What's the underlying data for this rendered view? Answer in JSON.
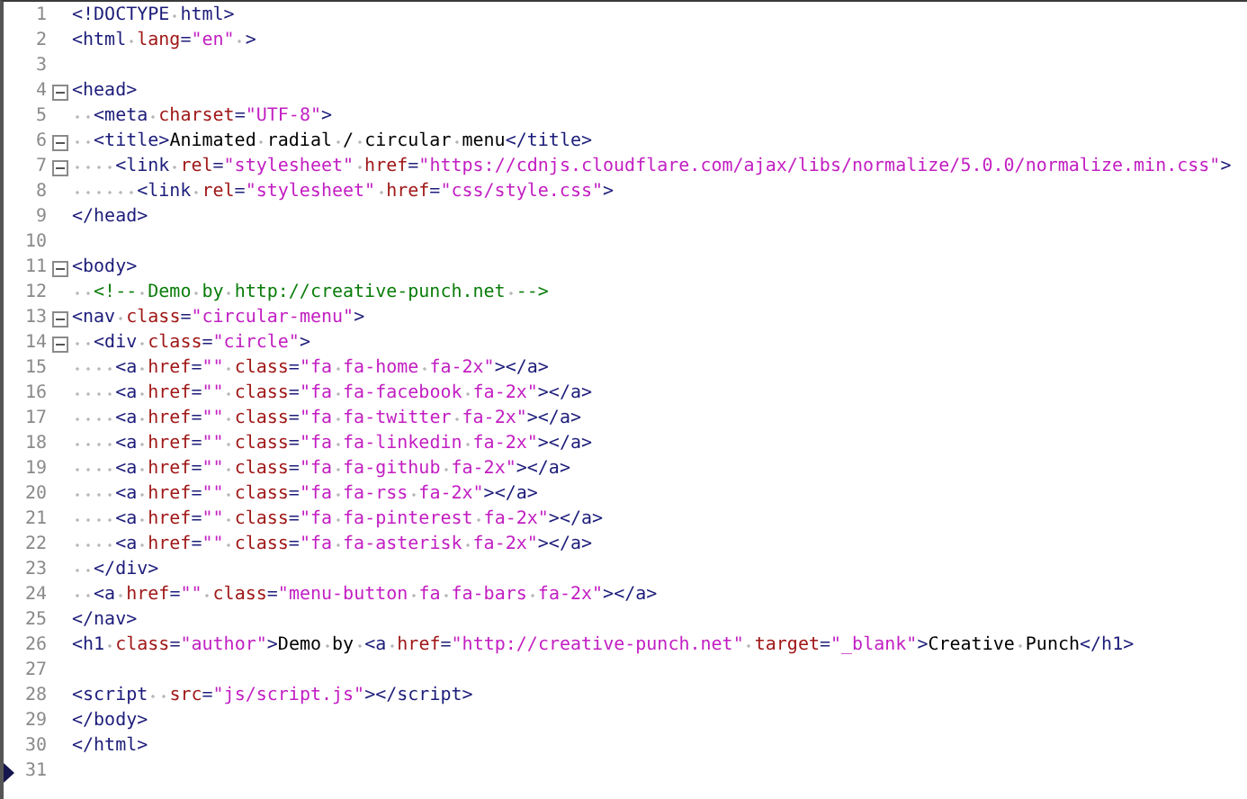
{
  "editor": {
    "lines": [
      {
        "n": "1",
        "fold": false,
        "current": false,
        "tokens": [
          {
            "kind": "tag",
            "text": "<!DOCTYPE html>"
          }
        ]
      },
      {
        "n": "2",
        "fold": false,
        "current": false,
        "tokens": [
          {
            "kind": "tag",
            "text": "<html "
          },
          {
            "kind": "attr",
            "text": "lang"
          },
          {
            "kind": "tag",
            "text": "="
          },
          {
            "kind": "value",
            "text": "\"en\""
          },
          {
            "kind": "tag",
            "text": " >"
          }
        ]
      },
      {
        "n": "3",
        "fold": false,
        "current": false
      },
      {
        "n": "4",
        "fold": true,
        "current": false,
        "tokens": [
          {
            "kind": "tag",
            "text": "<head>"
          }
        ]
      },
      {
        "n": "5",
        "fold": false,
        "current": false,
        "tokens": [
          {
            "kind": "tag",
            "text": "  <meta "
          },
          {
            "kind": "attr",
            "text": "charset"
          },
          {
            "kind": "tag",
            "text": "="
          },
          {
            "kind": "value",
            "text": "\"UTF-8\""
          },
          {
            "kind": "tag",
            "text": ">"
          }
        ]
      },
      {
        "n": "6",
        "fold": true,
        "current": false,
        "tokens": [
          {
            "kind": "tag",
            "text": "  <title>"
          },
          {
            "kind": "text",
            "text": "Animated radial / circular menu"
          },
          {
            "kind": "tag",
            "text": "</title>"
          }
        ]
      },
      {
        "n": "7",
        "fold": true,
        "current": false,
        "tokens": [
          {
            "kind": "tag",
            "text": "    <link "
          },
          {
            "kind": "attr",
            "text": "rel"
          },
          {
            "kind": "tag",
            "text": "="
          },
          {
            "kind": "value",
            "text": "\"stylesheet\" "
          },
          {
            "kind": "attr",
            "text": "href"
          },
          {
            "kind": "tag",
            "text": "="
          },
          {
            "kind": "value",
            "text": "\"https://cdnjs.cloudflare.com/ajax/libs/normalize/5.0.0/normalize.min.css\""
          },
          {
            "kind": "tag",
            "text": ">"
          }
        ]
      },
      {
        "n": "8",
        "fold": false,
        "current": false,
        "tokens": [
          {
            "kind": "tag",
            "text": "      <link "
          },
          {
            "kind": "attr",
            "text": "rel"
          },
          {
            "kind": "tag",
            "text": "="
          },
          {
            "kind": "value",
            "text": "\"stylesheet\" "
          },
          {
            "kind": "attr",
            "text": "href"
          },
          {
            "kind": "tag",
            "text": "="
          },
          {
            "kind": "value",
            "text": "\"css/style.css\""
          },
          {
            "kind": "tag",
            "text": ">"
          }
        ]
      },
      {
        "n": "9",
        "fold": false,
        "current": false,
        "tokens": [
          {
            "kind": "tag",
            "text": "</head>"
          }
        ]
      },
      {
        "n": "10",
        "fold": false,
        "current": false
      },
      {
        "n": "11",
        "fold": true,
        "current": false,
        "tokens": [
          {
            "kind": "tag",
            "text": "<body>"
          }
        ]
      },
      {
        "n": "12",
        "fold": false,
        "current": false,
        "tokens": [
          {
            "kind": "comment",
            "text": "  <!-- Demo by http://creative-punch.net -->"
          }
        ]
      },
      {
        "n": "13",
        "fold": true,
        "current": false,
        "tokens": [
          {
            "kind": "tag",
            "text": "<nav "
          },
          {
            "kind": "attr",
            "text": "class"
          },
          {
            "kind": "tag",
            "text": "="
          },
          {
            "kind": "value",
            "text": "\"circular-menu\""
          },
          {
            "kind": "tag",
            "text": ">"
          }
        ]
      },
      {
        "n": "14",
        "fold": true,
        "current": false,
        "tokens": [
          {
            "kind": "tag",
            "text": "  <div "
          },
          {
            "kind": "attr",
            "text": "class"
          },
          {
            "kind": "tag",
            "text": "="
          },
          {
            "kind": "value",
            "text": "\"circle\""
          },
          {
            "kind": "tag",
            "text": ">"
          }
        ]
      },
      {
        "n": "15",
        "fold": false,
        "current": false,
        "tokens": [
          {
            "kind": "tag",
            "text": "    <a "
          },
          {
            "kind": "attr",
            "text": "href"
          },
          {
            "kind": "tag",
            "text": "="
          },
          {
            "kind": "value",
            "text": "\"\" "
          },
          {
            "kind": "attr",
            "text": "class"
          },
          {
            "kind": "tag",
            "text": "="
          },
          {
            "kind": "value",
            "text": "\"fa fa-home fa-2x\""
          },
          {
            "kind": "tag",
            "text": "></a>"
          }
        ]
      },
      {
        "n": "16",
        "fold": false,
        "current": false,
        "tokens": [
          {
            "kind": "tag",
            "text": "    <a "
          },
          {
            "kind": "attr",
            "text": "href"
          },
          {
            "kind": "tag",
            "text": "="
          },
          {
            "kind": "value",
            "text": "\"\" "
          },
          {
            "kind": "attr",
            "text": "class"
          },
          {
            "kind": "tag",
            "text": "="
          },
          {
            "kind": "value",
            "text": "\"fa fa-facebook fa-2x\""
          },
          {
            "kind": "tag",
            "text": "></a>"
          }
        ]
      },
      {
        "n": "17",
        "fold": false,
        "current": false,
        "tokens": [
          {
            "kind": "tag",
            "text": "    <a "
          },
          {
            "kind": "attr",
            "text": "href"
          },
          {
            "kind": "tag",
            "text": "="
          },
          {
            "kind": "value",
            "text": "\"\" "
          },
          {
            "kind": "attr",
            "text": "class"
          },
          {
            "kind": "tag",
            "text": "="
          },
          {
            "kind": "value",
            "text": "\"fa fa-twitter fa-2x\""
          },
          {
            "kind": "tag",
            "text": "></a>"
          }
        ]
      },
      {
        "n": "18",
        "fold": false,
        "current": false,
        "tokens": [
          {
            "kind": "tag",
            "text": "    <a "
          },
          {
            "kind": "attr",
            "text": "href"
          },
          {
            "kind": "tag",
            "text": "="
          },
          {
            "kind": "value",
            "text": "\"\" "
          },
          {
            "kind": "attr",
            "text": "class"
          },
          {
            "kind": "tag",
            "text": "="
          },
          {
            "kind": "value",
            "text": "\"fa fa-linkedin fa-2x\""
          },
          {
            "kind": "tag",
            "text": "></a>"
          }
        ]
      },
      {
        "n": "19",
        "fold": false,
        "current": false,
        "tokens": [
          {
            "kind": "tag",
            "text": "    <a "
          },
          {
            "kind": "attr",
            "text": "href"
          },
          {
            "kind": "tag",
            "text": "="
          },
          {
            "kind": "value",
            "text": "\"\" "
          },
          {
            "kind": "attr",
            "text": "class"
          },
          {
            "kind": "tag",
            "text": "="
          },
          {
            "kind": "value",
            "text": "\"fa fa-github fa-2x\""
          },
          {
            "kind": "tag",
            "text": "></a>"
          }
        ]
      },
      {
        "n": "20",
        "fold": false,
        "current": false,
        "tokens": [
          {
            "kind": "tag",
            "text": "    <a "
          },
          {
            "kind": "attr",
            "text": "href"
          },
          {
            "kind": "tag",
            "text": "="
          },
          {
            "kind": "value",
            "text": "\"\" "
          },
          {
            "kind": "attr",
            "text": "class"
          },
          {
            "kind": "tag",
            "text": "="
          },
          {
            "kind": "value",
            "text": "\"fa fa-rss fa-2x\""
          },
          {
            "kind": "tag",
            "text": "></a>"
          }
        ]
      },
      {
        "n": "21",
        "fold": false,
        "current": false,
        "tokens": [
          {
            "kind": "tag",
            "text": "    <a "
          },
          {
            "kind": "attr",
            "text": "href"
          },
          {
            "kind": "tag",
            "text": "="
          },
          {
            "kind": "value",
            "text": "\"\" "
          },
          {
            "kind": "attr",
            "text": "class"
          },
          {
            "kind": "tag",
            "text": "="
          },
          {
            "kind": "value",
            "text": "\"fa fa-pinterest fa-2x\""
          },
          {
            "kind": "tag",
            "text": "></a>"
          }
        ]
      },
      {
        "n": "22",
        "fold": false,
        "current": false,
        "tokens": [
          {
            "kind": "tag",
            "text": "    <a "
          },
          {
            "kind": "attr",
            "text": "href"
          },
          {
            "kind": "tag",
            "text": "="
          },
          {
            "kind": "value",
            "text": "\"\" "
          },
          {
            "kind": "attr",
            "text": "class"
          },
          {
            "kind": "tag",
            "text": "="
          },
          {
            "kind": "value",
            "text": "\"fa fa-asterisk fa-2x\""
          },
          {
            "kind": "tag",
            "text": "></a>"
          }
        ]
      },
      {
        "n": "23",
        "fold": false,
        "current": false,
        "tokens": [
          {
            "kind": "tag",
            "text": "  </div>"
          }
        ]
      },
      {
        "n": "24",
        "fold": false,
        "current": false,
        "tokens": [
          {
            "kind": "tag",
            "text": "  <a "
          },
          {
            "kind": "attr",
            "text": "href"
          },
          {
            "kind": "tag",
            "text": "="
          },
          {
            "kind": "value",
            "text": "\"\" "
          },
          {
            "kind": "attr",
            "text": "class"
          },
          {
            "kind": "tag",
            "text": "="
          },
          {
            "kind": "value",
            "text": "\"menu-button fa fa-bars fa-2x\""
          },
          {
            "kind": "tag",
            "text": "></a>"
          }
        ]
      },
      {
        "n": "25",
        "fold": false,
        "current": false,
        "tokens": [
          {
            "kind": "tag",
            "text": "</nav>"
          }
        ]
      },
      {
        "n": "26",
        "fold": false,
        "current": false,
        "tokens": [
          {
            "kind": "tag",
            "text": "<h1 "
          },
          {
            "kind": "attr",
            "text": "class"
          },
          {
            "kind": "tag",
            "text": "="
          },
          {
            "kind": "value",
            "text": "\"author\""
          },
          {
            "kind": "tag",
            "text": ">"
          },
          {
            "kind": "text",
            "text": "Demo by "
          },
          {
            "kind": "tag",
            "text": "<a "
          },
          {
            "kind": "attr",
            "text": "href"
          },
          {
            "kind": "tag",
            "text": "="
          },
          {
            "kind": "value",
            "text": "\"http://creative-punch.net\" "
          },
          {
            "kind": "attr",
            "text": "target"
          },
          {
            "kind": "tag",
            "text": "="
          },
          {
            "kind": "value",
            "text": "\"_blank\""
          },
          {
            "kind": "tag",
            "text": ">"
          },
          {
            "kind": "text",
            "text": "Creative Punch"
          },
          {
            "kind": "tag",
            "text": "</h1>"
          }
        ]
      },
      {
        "n": "27",
        "fold": false,
        "current": false
      },
      {
        "n": "28",
        "fold": false,
        "current": false,
        "tokens": [
          {
            "kind": "tag",
            "text": "<script  "
          },
          {
            "kind": "attr",
            "text": "src"
          },
          {
            "kind": "tag",
            "text": "="
          },
          {
            "kind": "value",
            "text": "\"js/script.js\""
          },
          {
            "kind": "tag",
            "text": "></script>"
          }
        ]
      },
      {
        "n": "29",
        "fold": false,
        "current": false,
        "tokens": [
          {
            "kind": "tag",
            "text": "</body>"
          }
        ]
      },
      {
        "n": "30",
        "fold": false,
        "current": false,
        "tokens": [
          {
            "kind": "tag",
            "text": "</html>"
          }
        ]
      },
      {
        "n": "31",
        "fold": false,
        "current": true
      }
    ]
  }
}
